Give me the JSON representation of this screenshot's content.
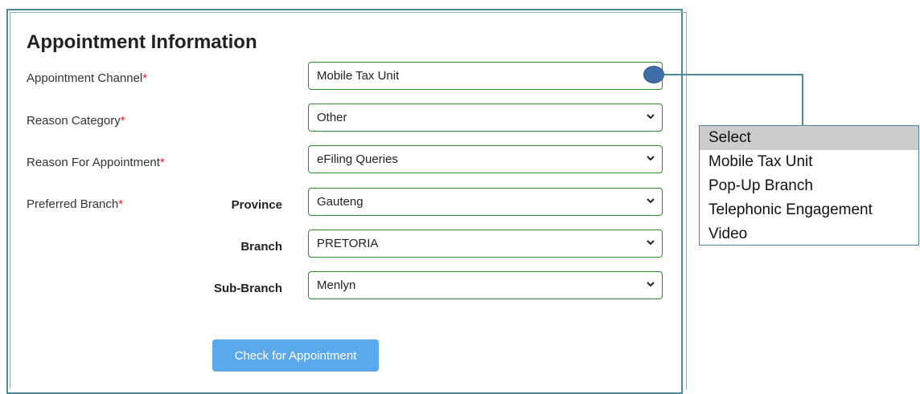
{
  "form": {
    "title": "Appointment Information",
    "fields": {
      "channel": {
        "label": "Appointment Channel",
        "required": "*",
        "value": "Mobile Tax Unit"
      },
      "reason_category": {
        "label": "Reason Category",
        "required": "*",
        "value": "Other"
      },
      "reason": {
        "label": "Reason For Appointment",
        "required": "*",
        "value": "eFiling Queries"
      },
      "preferred_branch": {
        "label": "Preferred Branch",
        "required": "*"
      },
      "province": {
        "label": "Province",
        "value": "Gauteng"
      },
      "branch": {
        "label": "Branch",
        "value": "PRETORIA"
      },
      "sub_branch": {
        "label": "Sub-Branch",
        "value": "Menlyn"
      }
    },
    "submit_label": "Check for Appointment"
  },
  "channel_dropdown": {
    "options": [
      "Select",
      "Mobile Tax Unit",
      "Pop-Up Branch",
      "Telephonic Engagement",
      "Video"
    ],
    "highlighted": "Select"
  },
  "colors": {
    "field_border": "#2e8b2e",
    "button_bg": "#5aa9ec",
    "required_star": "#d9232d",
    "panel_border": "#4a8a9a",
    "pointer_dot": "#3d6ea8"
  }
}
